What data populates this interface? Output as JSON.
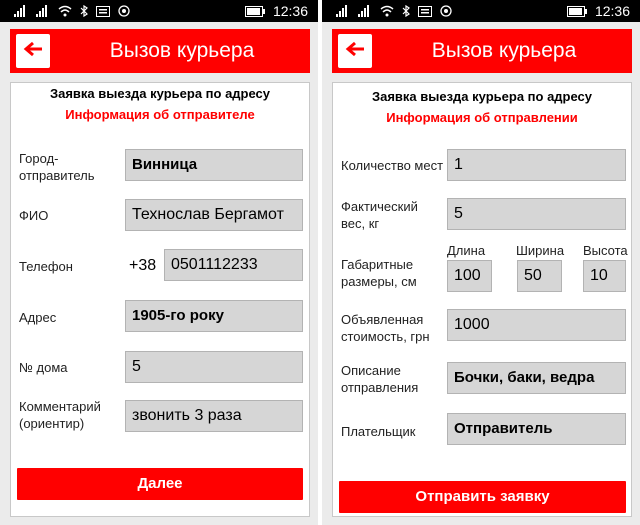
{
  "status": {
    "time": "12:36"
  },
  "colors": {
    "accent": "#ff0000",
    "field_bg": "#d6d6d6"
  },
  "left": {
    "title": "Вызов курьера",
    "heading": "Заявка выезда курьера по адресу",
    "subheading": "Информация об отправителе",
    "fields": {
      "city": {
        "label": "Город-\nотправитель",
        "value": "Винница"
      },
      "fio": {
        "label": "ФИО",
        "value": "Технослав Бергамот"
      },
      "phone": {
        "label": "Телефон",
        "prefix": "+38",
        "value": "0501112233"
      },
      "address": {
        "label": "Адрес",
        "value": "1905-го року"
      },
      "house": {
        "label": "№ дома",
        "value": "5"
      },
      "comment": {
        "label": "Комментарий\n(ориентир)",
        "value": "звонить 3 раза"
      }
    },
    "next_button": "Далее"
  },
  "right": {
    "title": "Вызов курьера",
    "heading": "Заявка выезда курьера по адресу",
    "subheading": "Информация об отправлении",
    "fields": {
      "places": {
        "label": "Количество мест",
        "value": "1"
      },
      "weight": {
        "label": "Фактический\nвес, кг",
        "value": "5"
      },
      "dims": {
        "label": "Габаритные\nразмеры, см",
        "length_label": "Длина",
        "length": "100",
        "width_label": "Ширина",
        "width": "50",
        "height_label": "Высота",
        "height": "10"
      },
      "declared": {
        "label": "Объявленная\nстоимость, грн",
        "value": "1000"
      },
      "description": {
        "label": "Описание\nотправления",
        "value": "Бочки, баки, ведра"
      },
      "payer": {
        "label": "Плательщик",
        "value": "Отправитель"
      }
    },
    "submit_button": "Отправить заявку"
  }
}
